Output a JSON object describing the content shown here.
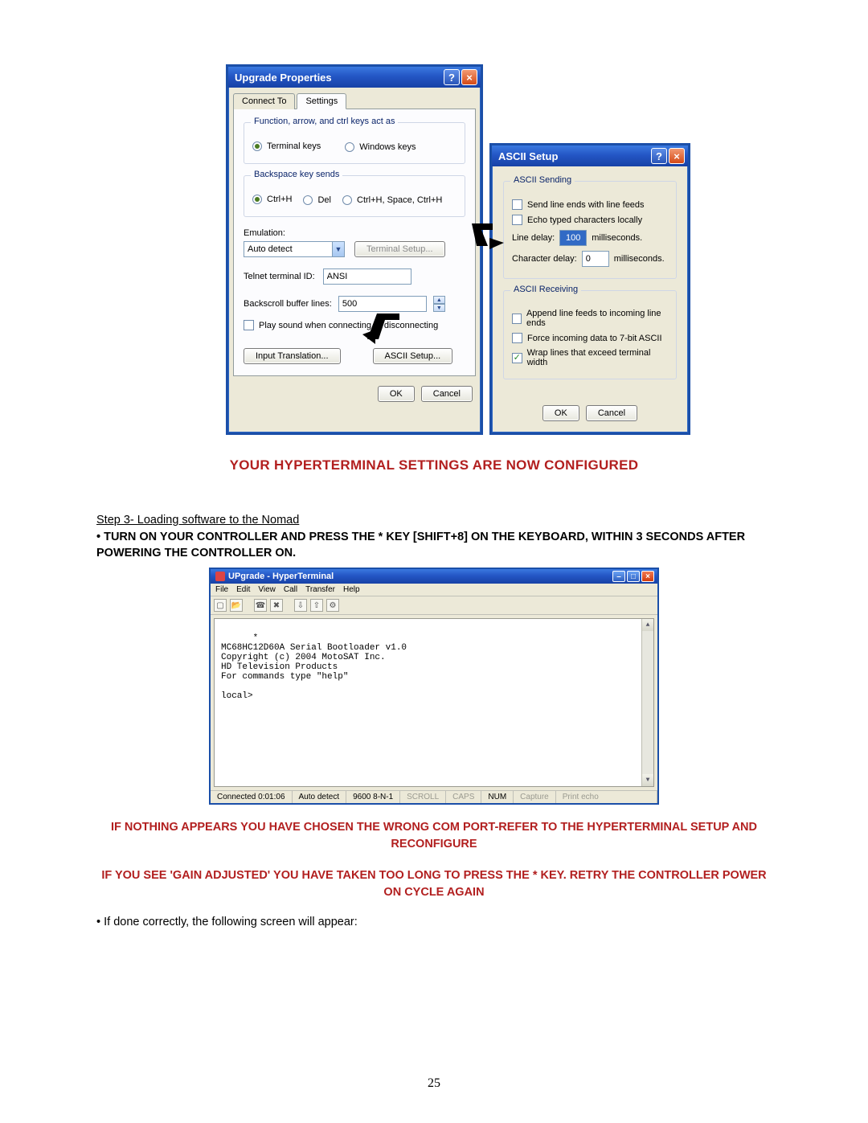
{
  "upgrade": {
    "title": "Upgrade Properties",
    "tabs": {
      "connect": "Connect To",
      "settings": "Settings"
    },
    "group_keys": {
      "legend": "Function, arrow, and ctrl keys act as",
      "opt_terminal": "Terminal keys",
      "opt_windows": "Windows keys"
    },
    "group_backspace": {
      "legend": "Backspace key sends",
      "opt1": "Ctrl+H",
      "opt2": "Del",
      "opt3": "Ctrl+H, Space, Ctrl+H"
    },
    "emulation_label": "Emulation:",
    "emulation_value": "Auto detect",
    "terminal_setup_btn": "Terminal Setup...",
    "telnet_label": "Telnet terminal ID:",
    "telnet_value": "ANSI",
    "backscroll_label": "Backscroll buffer lines:",
    "backscroll_value": "500",
    "play_sound": "Play sound when connecting or disconnecting",
    "input_translation_btn": "Input Translation...",
    "ascii_setup_btn": "ASCII Setup...",
    "ok": "OK",
    "cancel": "Cancel"
  },
  "ascii": {
    "title": "ASCII Setup",
    "sending_legend": "ASCII Sending",
    "send_line_ends": "Send line ends with line feeds",
    "echo_local": "Echo typed characters locally",
    "line_delay_label": "Line delay:",
    "line_delay_value": "100",
    "char_delay_label": "Character delay:",
    "char_delay_value": "0",
    "ms": "milliseconds.",
    "receiving_legend": "ASCII Receiving",
    "append_lf": "Append line feeds to incoming line ends",
    "force_7bit": "Force incoming data to 7-bit ASCII",
    "wrap": "Wrap lines that exceed terminal width",
    "ok": "OK",
    "cancel": "Cancel"
  },
  "doc": {
    "headline": "YOUR HYPERTERMINAL SETTINGS ARE NOW CONFIGURED",
    "step": "Step 3- Loading software to the Nomad",
    "instr1": "• TURN ON YOUR CONTROLLER AND PRESS THE * KEY [SHIFT+8] ON THE KEYBOARD, WITHIN 3 SECONDS AFTER POWERING THE CONTROLLER ON.",
    "warn1": "IF NOTHING APPEARS YOU HAVE CHOSEN THE WRONG COM PORT-REFER TO THE HYPERTERMINAL SETUP AND RECONFIGURE",
    "warn2": "IF YOU SEE 'GAIN ADJUSTED' YOU HAVE TAKEN TOO LONG TO PRESS THE * KEY. RETRY THE CONTROLLER POWER ON CYCLE AGAIN",
    "done": "• If done correctly, the following screen will appear:",
    "page": "25"
  },
  "ht": {
    "title": "UPgrade - HyperTerminal",
    "menus": [
      "File",
      "Edit",
      "View",
      "Call",
      "Transfer",
      "Help"
    ],
    "terminal_text": "*\nMC68HC12D60A Serial Bootloader v1.0\nCopyright (c) 2004 MotoSAT Inc.\nHD Television Products\nFor commands type \"help\"\n\nlocal>",
    "status": {
      "conn": "Connected 0:01:06",
      "detect": "Auto detect",
      "rate": "9600 8-N-1",
      "scroll": "SCROLL",
      "caps": "CAPS",
      "num": "NUM",
      "capture": "Capture",
      "echo": "Print echo"
    }
  }
}
